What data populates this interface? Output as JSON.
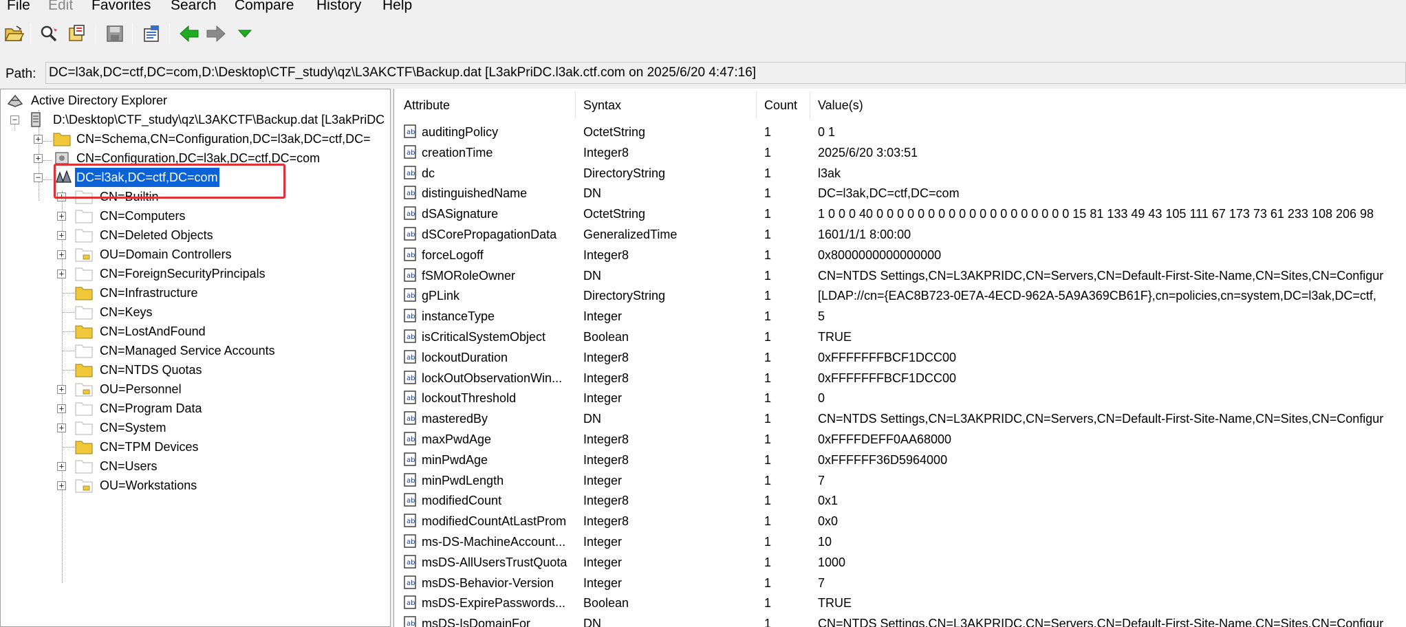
{
  "menu": [
    "File",
    "Edit",
    "Favorites",
    "Search",
    "Compare",
    "History",
    "Help"
  ],
  "menu_disabled": [
    false,
    true,
    false,
    false,
    false,
    false,
    false
  ],
  "toolbar": {
    "icons": [
      "open-folder-icon",
      "search-icon",
      "find-object-icon",
      "save-icon",
      "properties-icon",
      "back-arrow-icon",
      "forward-arrow-icon",
      "dropdown-arrow-icon"
    ],
    "colors": {
      "back_arrow": "#22aa22",
      "forward_arrow": "#8a8a8a",
      "dropdown": "#22aa22"
    }
  },
  "path": {
    "label": "Path:",
    "value": "DC=l3ak,DC=ctf,DC=com,D:\\Desktop\\CTF_study\\qz\\L3AKCTF\\Backup.dat [L3akPriDC.l3ak.ctf.com on 2025/6/20 4:47:16]"
  },
  "tree": {
    "root": "Active Directory Explorer",
    "snapshot": "D:\\Desktop\\CTF_study\\qz\\L3AKCTF\\Backup.dat [L3akPriDC",
    "naming_contexts": [
      "CN=Schema,CN=Configuration,DC=l3ak,DC=ctf,DC=",
      "CN=Configuration,DC=l3ak,DC=ctf,DC=com",
      "DC=l3ak,DC=ctf,DC=com"
    ],
    "children": [
      "CN=Builtin",
      "CN=Computers",
      "CN=Deleted Objects",
      "OU=Domain Controllers",
      "CN=ForeignSecurityPrincipals",
      "CN=Infrastructure",
      "CN=Keys",
      "CN=LostAndFound",
      "CN=Managed Service Accounts",
      "CN=NTDS Quotas",
      "OU=Personnel",
      "CN=Program Data",
      "CN=System",
      "CN=TPM Devices",
      "CN=Users",
      "OU=Workstations"
    ],
    "children_expandable": [
      true,
      true,
      true,
      true,
      true,
      false,
      false,
      false,
      false,
      false,
      true,
      true,
      true,
      false,
      true,
      true
    ],
    "children_icon": [
      "container",
      "container",
      "container",
      "ou",
      "container",
      "folder",
      "container",
      "folder",
      "container",
      "folder",
      "ou",
      "container",
      "container",
      "folder",
      "container",
      "ou"
    ],
    "selection_color": "#0a62d6",
    "highlight_color": "#e0303a"
  },
  "table": {
    "columns": [
      "Attribute",
      "Syntax",
      "Count",
      "Value(s)"
    ],
    "rows": [
      [
        "auditingPolicy",
        "OctetString",
        "1",
        "0 1"
      ],
      [
        "creationTime",
        "Integer8",
        "1",
        "2025/6/20 3:03:51"
      ],
      [
        "dc",
        "DirectoryString",
        "1",
        "l3ak"
      ],
      [
        "distinguishedName",
        "DN",
        "1",
        "DC=l3ak,DC=ctf,DC=com"
      ],
      [
        "dSASignature",
        "OctetString",
        "1",
        "1 0 0 0 40 0 0 0 0 0 0 0 0 0 0 0 0 0 0 0 0 0 0 0 15 81 133 49 43 105 111 67 173 73 61 233 108 206 98"
      ],
      [
        "dSCorePropagationData",
        "GeneralizedTime",
        "1",
        "1601/1/1 8:00:00"
      ],
      [
        "forceLogoff",
        "Integer8",
        "1",
        "0x8000000000000000"
      ],
      [
        "fSMORoleOwner",
        "DN",
        "1",
        "CN=NTDS Settings,CN=L3AKPRIDC,CN=Servers,CN=Default-First-Site-Name,CN=Sites,CN=Configur"
      ],
      [
        "gPLink",
        "DirectoryString",
        "1",
        "[LDAP://cn={EAC8B723-0E7A-4ECD-962A-5A9A369CB61F},cn=policies,cn=system,DC=l3ak,DC=ctf,"
      ],
      [
        "instanceType",
        "Integer",
        "1",
        "5"
      ],
      [
        "isCriticalSystemObject",
        "Boolean",
        "1",
        "TRUE"
      ],
      [
        "lockoutDuration",
        "Integer8",
        "1",
        "0xFFFFFFFBCF1DCC00"
      ],
      [
        "lockOutObservationWin...",
        "Integer8",
        "1",
        "0xFFFFFFFBCF1DCC00"
      ],
      [
        "lockoutThreshold",
        "Integer",
        "1",
        "0"
      ],
      [
        "masteredBy",
        "DN",
        "1",
        "CN=NTDS Settings,CN=L3AKPRIDC,CN=Servers,CN=Default-First-Site-Name,CN=Sites,CN=Configur"
      ],
      [
        "maxPwdAge",
        "Integer8",
        "1",
        "0xFFFFDEFF0AA68000"
      ],
      [
        "minPwdAge",
        "Integer8",
        "1",
        "0xFFFFFF36D5964000"
      ],
      [
        "minPwdLength",
        "Integer",
        "1",
        "7"
      ],
      [
        "modifiedCount",
        "Integer8",
        "1",
        "0x1"
      ],
      [
        "modifiedCountAtLastProm",
        "Integer8",
        "1",
        "0x0"
      ],
      [
        "ms-DS-MachineAccount...",
        "Integer",
        "1",
        "10"
      ],
      [
        "msDS-AllUsersTrustQuota",
        "Integer",
        "1",
        "1000"
      ],
      [
        "msDS-Behavior-Version",
        "Integer",
        "1",
        "7"
      ],
      [
        "msDS-ExpirePasswords...",
        "Boolean",
        "1",
        "TRUE"
      ],
      [
        "msDS-IsDomainFor",
        "DN",
        "1",
        "CN=NTDS Settings,CN=L3AKPRIDC,CN=Servers,CN=Default-First-Site-Name,CN=Sites,CN=Configur"
      ]
    ]
  }
}
